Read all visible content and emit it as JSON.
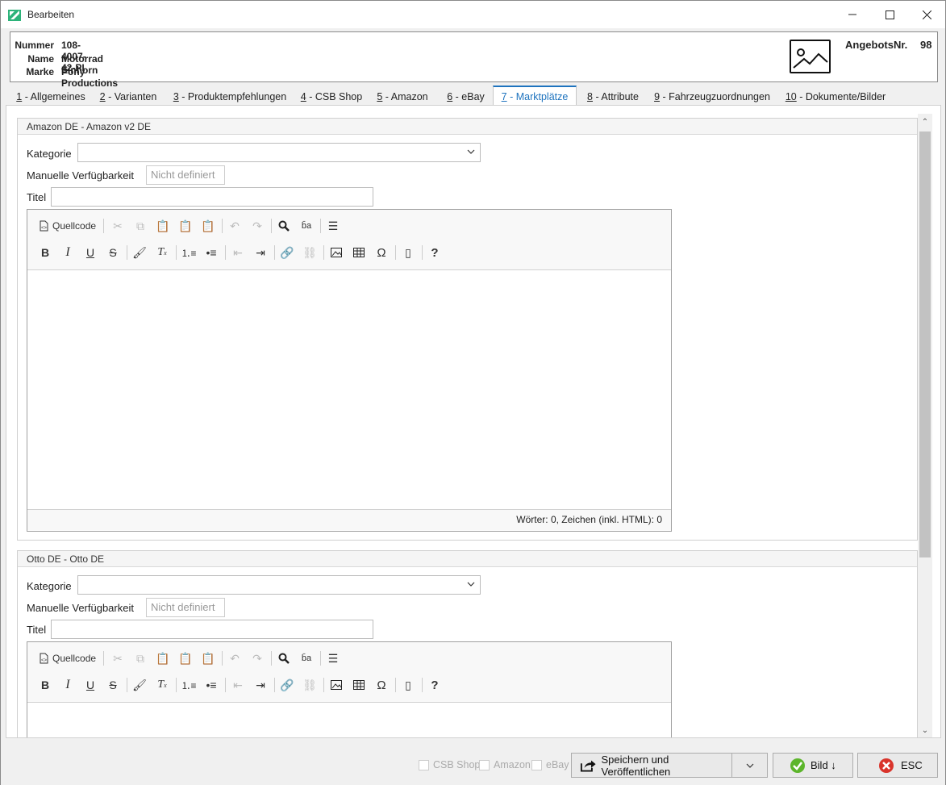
{
  "window": {
    "title": "Bearbeiten"
  },
  "header": {
    "fields": [
      {
        "label": "Nummer",
        "value": "108-4007-42-PI"
      },
      {
        "label": "Name",
        "value": "Motorrad Einhorn"
      },
      {
        "label": "Marke",
        "value": "Pony Productions"
      }
    ],
    "offer_label": "AngebotsNr.",
    "offer_value": "98"
  },
  "tabs": [
    {
      "key": "1",
      "label": " - Allgemeines"
    },
    {
      "key": "2",
      "label": " - Varianten"
    },
    {
      "key": "3",
      "label": " - Produktempfehlungen"
    },
    {
      "key": "4",
      "label": " - CSB Shop"
    },
    {
      "key": "5",
      "label": " - Amazon"
    },
    {
      "key": "6",
      "label": " - eBay"
    },
    {
      "key": "7",
      "label": " - Marktplätze"
    },
    {
      "key": "8",
      "label": " - Attribute"
    },
    {
      "key": "9",
      "label": " - Fahrzeugzuordnungen"
    },
    {
      "key": "10",
      "label": " - Dokumente/Bilder"
    }
  ],
  "active_tab": "7",
  "marketplaces": [
    {
      "title": "Amazon DE - Amazon v2 DE",
      "kategorie_label": "Kategorie",
      "kategorie_value": "",
      "verf_label": "Manuelle Verfügbarkeit",
      "verf_value": "Nicht definiert",
      "titel_label": "Titel",
      "titel_value": "",
      "editor_status": "Wörter: 0, Zeichen (inkl. HTML): 0"
    },
    {
      "title": "Otto DE - Otto DE",
      "kategorie_label": "Kategorie",
      "kategorie_value": "",
      "verf_label": "Manuelle Verfügbarkeit",
      "verf_value": "Nicht definiert",
      "titel_label": "Titel",
      "titel_value": ""
    }
  ],
  "editor_toolbar": {
    "source_label": "Quellcode"
  },
  "bottom": {
    "checkboxes": [
      {
        "label": "CSB Shop",
        "checked": false
      },
      {
        "label": "Amazon",
        "checked": false
      },
      {
        "label": "eBay",
        "checked": false
      }
    ],
    "save_label": "Speichern und Veröffentlichen",
    "bild_label": "Bild ↓",
    "esc_label": "ESC"
  }
}
